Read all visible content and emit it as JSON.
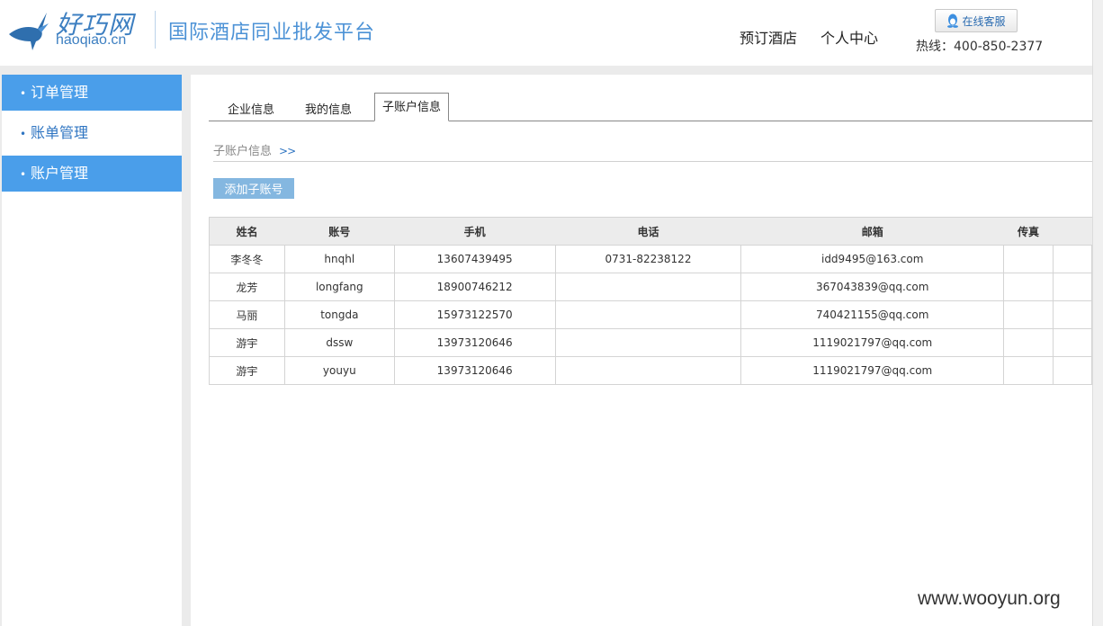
{
  "brand": {
    "logo_cn": "好巧网",
    "logo_en": "haoqiao.cn",
    "platform_title": "国际酒店同业批发平台"
  },
  "header": {
    "nav": [
      {
        "label": "预订酒店"
      },
      {
        "label": "个人中心"
      }
    ],
    "support_label": "在线客服",
    "hotline": "热线：400-850-2377"
  },
  "sidebar": {
    "items": [
      {
        "label": "订单管理",
        "active": true
      },
      {
        "label": "账单管理",
        "active": false
      },
      {
        "label": "账户管理",
        "active": true
      }
    ]
  },
  "tabs": [
    {
      "label": "企业信息"
    },
    {
      "label": "我的信息"
    },
    {
      "label": "子账户信息",
      "active": true
    }
  ],
  "breadcrumb": {
    "label": "子账户信息",
    "arrows": ">>"
  },
  "add_button": "添加子账号",
  "table": {
    "headers": [
      "姓名",
      "账号",
      "手机",
      "电话",
      "邮箱",
      "传真",
      ""
    ],
    "rows": [
      [
        "李冬冬",
        "hnqhl",
        "13607439495",
        "0731-82238122",
        "idd9495@163.com",
        "",
        ""
      ],
      [
        "龙芳",
        "longfang",
        "18900746212",
        "",
        "367043839@qq.com",
        "",
        ""
      ],
      [
        "马丽",
        "tongda",
        "15973122570",
        "",
        "740421155@qq.com",
        "",
        ""
      ],
      [
        "游宇",
        "dssw",
        "13973120646",
        "",
        "1119021797@qq.com",
        "",
        ""
      ],
      [
        "游宇",
        "youyu",
        "13973120646",
        "",
        "1119021797@qq.com",
        "",
        ""
      ]
    ]
  },
  "watermark": "www.wooyun.org",
  "colors": {
    "accent": "#4a9eea",
    "link": "#2f75c2",
    "add_button": "#84b7e0"
  }
}
